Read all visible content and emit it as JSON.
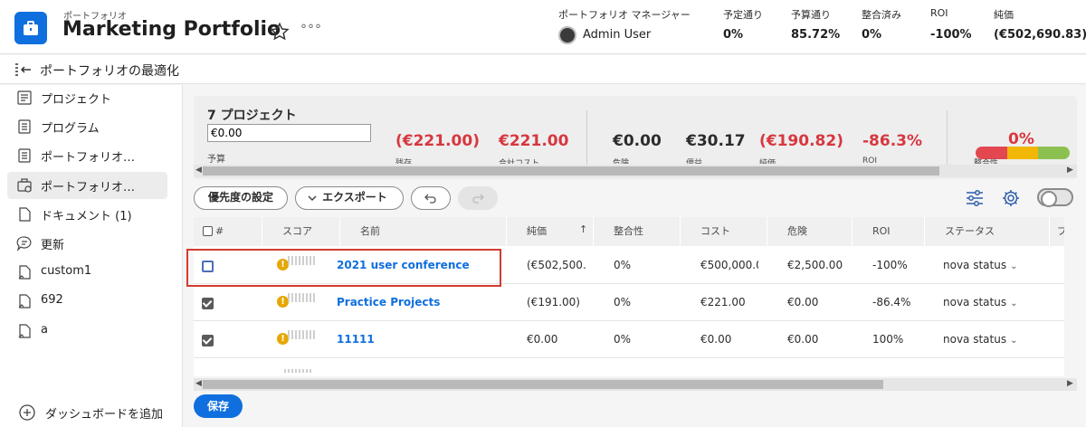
{
  "header": {
    "subtitle": "ポートフォリオ",
    "title": "Marketing Portfolio",
    "more": "°°°",
    "owner_label": "ポートフォリオ マネージャー",
    "owner": "Admin User",
    "metrics": [
      {
        "label": "予定通り",
        "value": "0%"
      },
      {
        "label": "予算通り",
        "value": "85.72%"
      },
      {
        "label": "整合済み",
        "value": "0%"
      },
      {
        "label": "ROI",
        "value": "-100%"
      },
      {
        "label": "純価",
        "value": "(€502,690.83)"
      }
    ]
  },
  "subheader": {
    "title": "ポートフォリオの最適化"
  },
  "sidebar": {
    "items": [
      {
        "label": "プロジェクト",
        "icon": "project-list-icon"
      },
      {
        "label": "プログラム",
        "icon": "program-icon"
      },
      {
        "label": "ポートフォリオ…",
        "icon": "document-list-icon"
      },
      {
        "label": "ポートフォリオ…",
        "icon": "portfolio-optimizer-icon",
        "active": true
      },
      {
        "label": "ドキュメント (1)",
        "icon": "document-icon"
      },
      {
        "label": "更新",
        "icon": "chat-icon"
      },
      {
        "label": "custom1",
        "icon": "custom-form-icon"
      },
      {
        "label": "692",
        "icon": "custom-form-icon"
      },
      {
        "label": "a",
        "icon": "custom-form-icon"
      }
    ],
    "add_dashboard": "ダッシュボードを追加"
  },
  "summary": {
    "title": "7 プロジェクト",
    "budget_value": "€0.00",
    "budget_label": "予算",
    "metrics": [
      {
        "value": "(€221.00)",
        "label": "残存",
        "color": "red"
      },
      {
        "value": "€221.00",
        "label": "合計コスト",
        "color": "red"
      },
      {
        "value": "€0.00",
        "label": "危険",
        "color": "black"
      },
      {
        "value": "€30.17",
        "label": "便益",
        "color": "black"
      },
      {
        "value": "(€190.82)",
        "label": "純価",
        "color": "red"
      },
      {
        "value": "-86.3%",
        "label": "ROI",
        "color": "red"
      }
    ],
    "alignment": {
      "value": "0%",
      "label": "整合性",
      "segments": [
        "#e34850",
        "#f2b705",
        "#8cc152"
      ]
    }
  },
  "toolbar": {
    "priority": "優先度の設定",
    "export": "エクスポート",
    "export_icon": "chevron-down-icon",
    "undo_icon": "undo-icon",
    "redo_icon": "redo-icon",
    "filter_icon": "sliders-icon",
    "settings_icon": "gear-icon"
  },
  "table": {
    "columns": [
      "#",
      "スコア",
      "名前",
      "純価",
      "整合性",
      "コスト",
      "危険",
      "ROI",
      "ステータス",
      "プ"
    ],
    "sort_indicator": "↑",
    "rows": [
      {
        "checked": false,
        "name": "2021 user conference",
        "net": "(€502,500.",
        "align": "0%",
        "cost": "€500,000.0",
        "risk": "€2,500.00",
        "roi": "-100%",
        "status": "nova status"
      },
      {
        "checked": true,
        "name": "Practice Projects",
        "net": "(€191.00)",
        "align": "0%",
        "cost": "€221.00",
        "risk": "€0.00",
        "roi": "-86.4%",
        "status": "nova status"
      },
      {
        "checked": true,
        "name": "11111",
        "net": "€0.00",
        "align": "0%",
        "cost": "€0.00",
        "risk": "€0.00",
        "roi": "100%",
        "status": "nova status"
      }
    ]
  },
  "save_label": "保存",
  "colors": {
    "accent": "#0f6fde",
    "negative": "#d7373f",
    "highlight": "#d33b2f"
  }
}
